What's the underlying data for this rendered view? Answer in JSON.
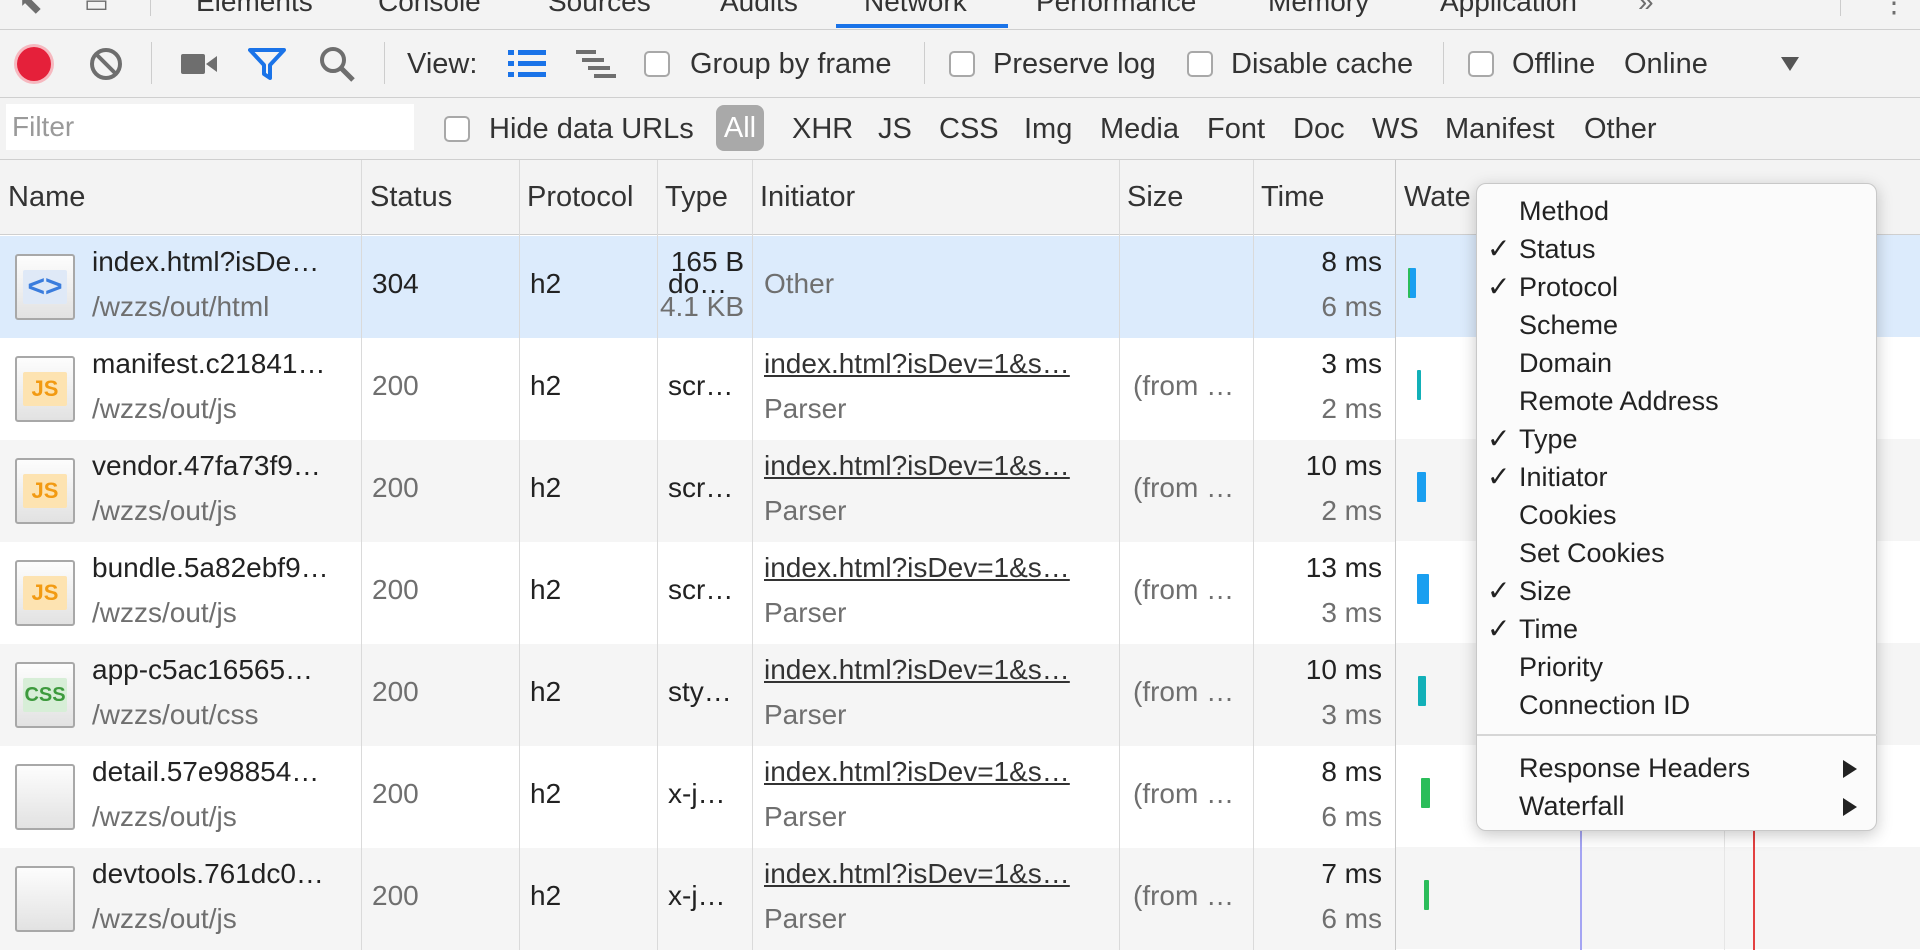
{
  "tabs": [
    {
      "label": "Elements"
    },
    {
      "label": "Console"
    },
    {
      "label": "Sources"
    },
    {
      "label": "Audits"
    },
    {
      "label": "Network"
    },
    {
      "label": "Performance"
    },
    {
      "label": "Memory"
    },
    {
      "label": "Application"
    }
  ],
  "toolbar": {
    "view_label": "View:",
    "group_by_frame": "Group by frame",
    "preserve_log": "Preserve log",
    "disable_cache": "Disable cache",
    "offline": "Offline",
    "throttle_value": "Online"
  },
  "filter": {
    "placeholder": "Filter",
    "hide_data_urls": "Hide data URLs",
    "types": [
      "All",
      "XHR",
      "JS",
      "CSS",
      "Img",
      "Media",
      "Font",
      "Doc",
      "WS",
      "Manifest",
      "Other"
    ]
  },
  "columns": [
    "Name",
    "Status",
    "Protocol",
    "Type",
    "Initiator",
    "Size",
    "Time",
    "Waterfall"
  ],
  "rows": [
    {
      "icon": "html-doc-icon",
      "name": "index.html?isDe…",
      "path": "/wzzs/out/html",
      "status": "304",
      "protocol": "h2",
      "type": "do…",
      "initiator": "Other",
      "initiator_sub": "",
      "size": "165 B",
      "size_sub": "4.1 KB",
      "time": "8 ms",
      "time_sub": "6 ms"
    },
    {
      "icon": "js-file-icon",
      "name": "manifest.c21841…",
      "path": "/wzzs/out/js",
      "status": "200",
      "protocol": "h2",
      "type": "scr…",
      "initiator": "index.html?isDev=1&s…",
      "initiator_sub": "Parser",
      "size": "(from …",
      "size_sub": "",
      "time": "3 ms",
      "time_sub": "2 ms"
    },
    {
      "icon": "js-file-icon",
      "name": "vendor.47fa73f9…",
      "path": "/wzzs/out/js",
      "status": "200",
      "protocol": "h2",
      "type": "scr…",
      "initiator": "index.html?isDev=1&s…",
      "initiator_sub": "Parser",
      "size": "(from …",
      "size_sub": "",
      "time": "10 ms",
      "time_sub": "2 ms"
    },
    {
      "icon": "js-file-icon",
      "name": "bundle.5a82ebf9…",
      "path": "/wzzs/out/js",
      "status": "200",
      "protocol": "h2",
      "type": "scr…",
      "initiator": "index.html?isDev=1&s…",
      "initiator_sub": "Parser",
      "size": "(from …",
      "size_sub": "",
      "time": "13 ms",
      "time_sub": "3 ms"
    },
    {
      "icon": "css-file-icon",
      "name": "app-c5ac16565…",
      "path": "/wzzs/out/css",
      "status": "200",
      "protocol": "h2",
      "type": "sty…",
      "initiator": "index.html?isDev=1&s…",
      "initiator_sub": "Parser",
      "size": "(from …",
      "size_sub": "",
      "time": "10 ms",
      "time_sub": "3 ms"
    },
    {
      "icon": "blank-file-icon",
      "name": "detail.57e98854…",
      "path": "/wzzs/out/js",
      "status": "200",
      "protocol": "h2",
      "type": "x-j…",
      "initiator": "index.html?isDev=1&s…",
      "initiator_sub": "Parser",
      "size": "(from …",
      "size_sub": "",
      "time": "8 ms",
      "time_sub": "6 ms"
    },
    {
      "icon": "blank-file-icon",
      "name": "devtools.761dc0…",
      "path": "/wzzs/out/js",
      "status": "200",
      "protocol": "h2",
      "type": "x-j…",
      "initiator": "index.html?isDev=1&s…",
      "initiator_sub": "Parser",
      "size": "(from …",
      "size_sub": "",
      "time": "7 ms",
      "time_sub": "6 ms"
    }
  ],
  "header_waterfall_label": "Wate",
  "context_menu": {
    "items": [
      {
        "label": "Method",
        "checked": false
      },
      {
        "label": "Status",
        "checked": true
      },
      {
        "label": "Protocol",
        "checked": true
      },
      {
        "label": "Scheme",
        "checked": false
      },
      {
        "label": "Domain",
        "checked": false
      },
      {
        "label": "Remote Address",
        "checked": false
      },
      {
        "label": "Type",
        "checked": true
      },
      {
        "label": "Initiator",
        "checked": true
      },
      {
        "label": "Cookies",
        "checked": false
      },
      {
        "label": "Set Cookies",
        "checked": false
      },
      {
        "label": "Size",
        "checked": true
      },
      {
        "label": "Time",
        "checked": true
      },
      {
        "label": "Priority",
        "checked": false
      },
      {
        "label": "Connection ID",
        "checked": false
      }
    ],
    "submenus": [
      {
        "label": "Response Headers"
      },
      {
        "label": "Waterfall"
      }
    ],
    "check_glyph": "✓"
  },
  "colors": {
    "accent": "#1a73e8",
    "record_red": "#e5203a",
    "filter_blue": "#1a73e8",
    "waterfall_teal": "#12b0b8",
    "waterfall_green": "#2bbd5a",
    "waterfall_blue": "#1a8df0",
    "dom_line": "#7b7bf0",
    "load_line": "#e34040"
  }
}
